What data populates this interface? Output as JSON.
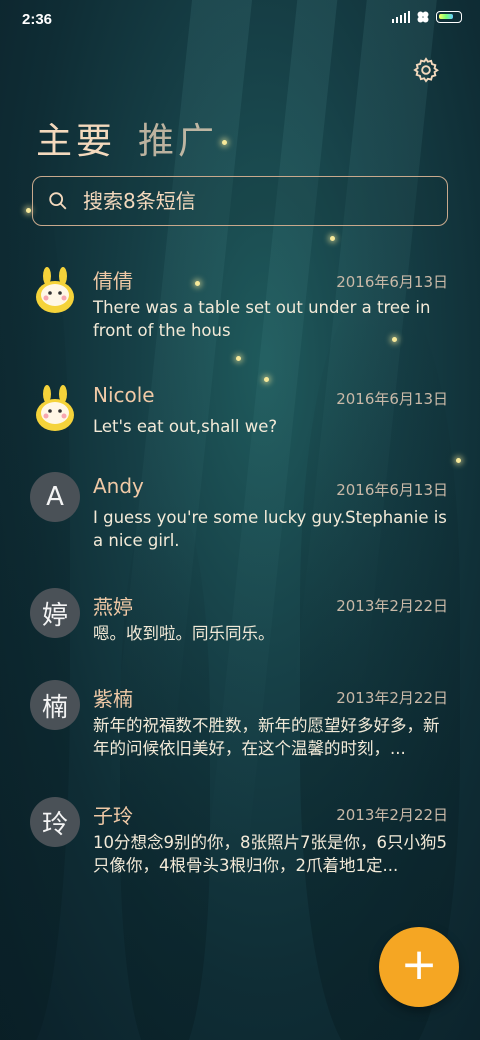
{
  "status_bar": {
    "time": "2:36",
    "icons": [
      "signal-icon",
      "clover-icon",
      "battery-icon"
    ]
  },
  "header": {
    "tabs": [
      {
        "label": "主要",
        "active": true
      },
      {
        "label": "推广",
        "active": false
      }
    ],
    "settings_icon": "gear-icon"
  },
  "search": {
    "placeholder": "搜索8条短信",
    "value": ""
  },
  "conversations": [
    {
      "avatar_text": "",
      "avatar_type": "bunny",
      "name": "倩倩",
      "date": "2016年6月13日",
      "preview": "There was a table set out under a tree in front of the hous"
    },
    {
      "avatar_text": "",
      "avatar_type": "bunny",
      "name": "Nicole",
      "date": "2016年6月13日",
      "preview": "Let's eat out,shall we?"
    },
    {
      "avatar_text": "A",
      "avatar_type": "letter",
      "name": "Andy",
      "date": "2016年6月13日",
      "preview": "I guess you're some lucky guy.Stephanie is a nice girl."
    },
    {
      "avatar_text": "婷",
      "avatar_type": "letter",
      "name": "燕婷",
      "date": "2013年2月22日",
      "preview": "嗯。收到啦。同乐同乐。"
    },
    {
      "avatar_text": "楠",
      "avatar_type": "letter",
      "name": "紫楠",
      "date": "2013年2月22日",
      "preview": "新年的祝福数不胜数，新年的愿望好多好多，新年的问候依旧美好，在这个温馨的时刻，..."
    },
    {
      "avatar_text": "玲",
      "avatar_type": "letter",
      "name": "子玲",
      "date": "2013年2月22日",
      "preview": "10分想念9别的你，8张照片7张是你，6只小狗5只像你，4根骨头3根归你，2爪着地1定..."
    }
  ],
  "fab": {
    "label": "+",
    "icon": "plus-icon"
  },
  "colors": {
    "accent": "#f5a623",
    "title": "#f4d9bd",
    "name": "#f0c9a6",
    "background": "#163f46",
    "avatar_bg": "#4a5157"
  }
}
